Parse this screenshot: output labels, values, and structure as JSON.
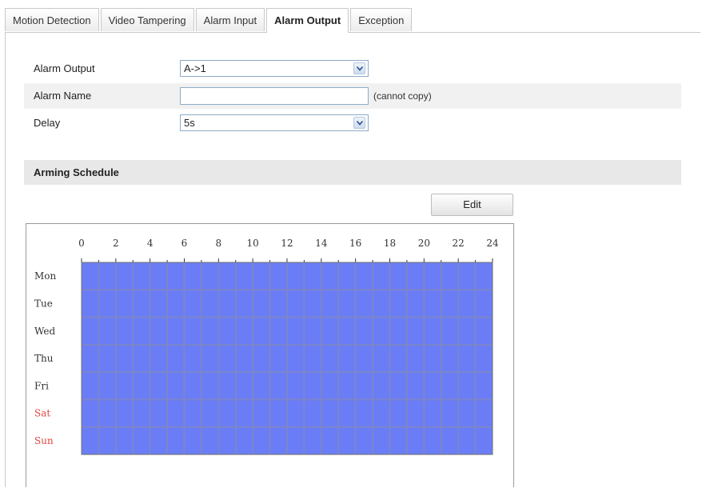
{
  "tabs": [
    {
      "label": "Motion Detection",
      "active": false
    },
    {
      "label": "Video Tampering",
      "active": false
    },
    {
      "label": "Alarm Input",
      "active": false
    },
    {
      "label": "Alarm Output",
      "active": true
    },
    {
      "label": "Exception",
      "active": false
    }
  ],
  "form": {
    "alarm_output": {
      "label": "Alarm Output",
      "value": "A->1"
    },
    "alarm_name": {
      "label": "Alarm Name",
      "value": "",
      "hint": "(cannot copy)"
    },
    "delay": {
      "label": "Delay",
      "value": "5s"
    }
  },
  "arming_schedule": {
    "title": "Arming Schedule",
    "edit_label": "Edit",
    "hour_ticks": [
      "0",
      "2",
      "4",
      "6",
      "8",
      "10",
      "12",
      "14",
      "16",
      "18",
      "20",
      "22",
      "24"
    ],
    "days": [
      {
        "label": "Mon",
        "weekend": false
      },
      {
        "label": "Tue",
        "weekend": false
      },
      {
        "label": "Wed",
        "weekend": false
      },
      {
        "label": "Thu",
        "weekend": false
      },
      {
        "label": "Fri",
        "weekend": false
      },
      {
        "label": "Sat",
        "weekend": true
      },
      {
        "label": "Sun",
        "weekend": true
      }
    ],
    "armed_hours": [
      0,
      24
    ],
    "colors": {
      "armed": "#6b7cf7",
      "grid_line": "#9ea5b8",
      "weekday_text": "#333333",
      "weekend_text": "#e0463f"
    }
  }
}
